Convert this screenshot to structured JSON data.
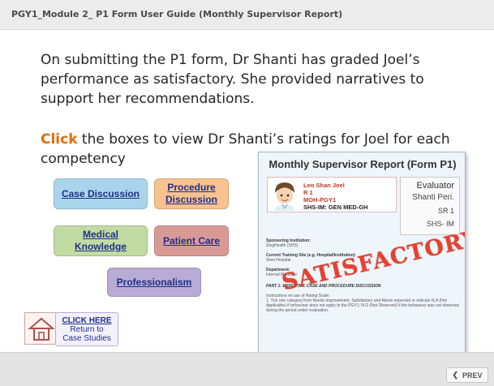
{
  "header": {
    "title": "PGY1_Module 2_ P1 Form User Guide (Monthly Supervisor Report)"
  },
  "slide": {
    "intro_text": "On submitting the P1 form, Dr Shanti has graded Joel’s performance as satisfactory. She provided narratives to support her recommendations.",
    "instruction_click": "Click",
    "instruction_rest": " the boxes to view Dr Shanti’s ratings for Joel for each competency",
    "competencies": {
      "case_discussion": "Case Discussion",
      "procedure_discussion": "Procedure Discussion",
      "medical_knowledge": "Medical Knowledge",
      "patient_care": "Patient Care",
      "professionalism": "Professionalism"
    },
    "return": {
      "line1": "CLICK HERE",
      "line2": "Return to",
      "line3": "Case Studies"
    }
  },
  "report": {
    "title": "Monthly Supervisor Report (Form P1)",
    "trainee_name": "Leo Shan Joel",
    "trainee_rank": "R 1",
    "trainee_program": "MOH-PGY1",
    "trainee_posting": "SHS-IM: GEN MED-GH",
    "evaluator_label": "Evaluator",
    "evaluator_name": "Shanti Peri.",
    "evaluator_rank": "SR 1",
    "evaluator_dept": "SHS- IM",
    "stamp": "SATISFACTORY",
    "sponsoring_label": "Sponsoring Institution:",
    "sponsoring_value": "SingHealth (SHS)",
    "current_training_label": "Current Training Site (e.g. Hospital/Institution):",
    "current_training_value": "Slow Hospital",
    "department_label": "Department:",
    "department_value": "Internal Medicine",
    "part1_heading": "PART 1: ESSENTIAL CASE AND PROCEDURE DISCUSSION",
    "instructions_label": "Instructions on use of Rating Scale:",
    "instructions_text": "1.      Tick one category from Needs Improvement, Satisfactory and Above expected or indicate N.A (Not Applicable) if behaviour does not apply to the PGY1; N.O (Not Observed) if the behaviour was not observed during the period under evaluation."
  },
  "footer": {
    "prev_label": "PREV"
  },
  "colors": {
    "case_discussion": "#a9d5ec",
    "procedure_discussion": "#f8c28f",
    "medical_knowledge": "#c2dba3",
    "patient_care": "#d99a95",
    "professionalism": "#b8abd6",
    "stamp": "#e5331f",
    "click_accent": "#e26b0a"
  }
}
